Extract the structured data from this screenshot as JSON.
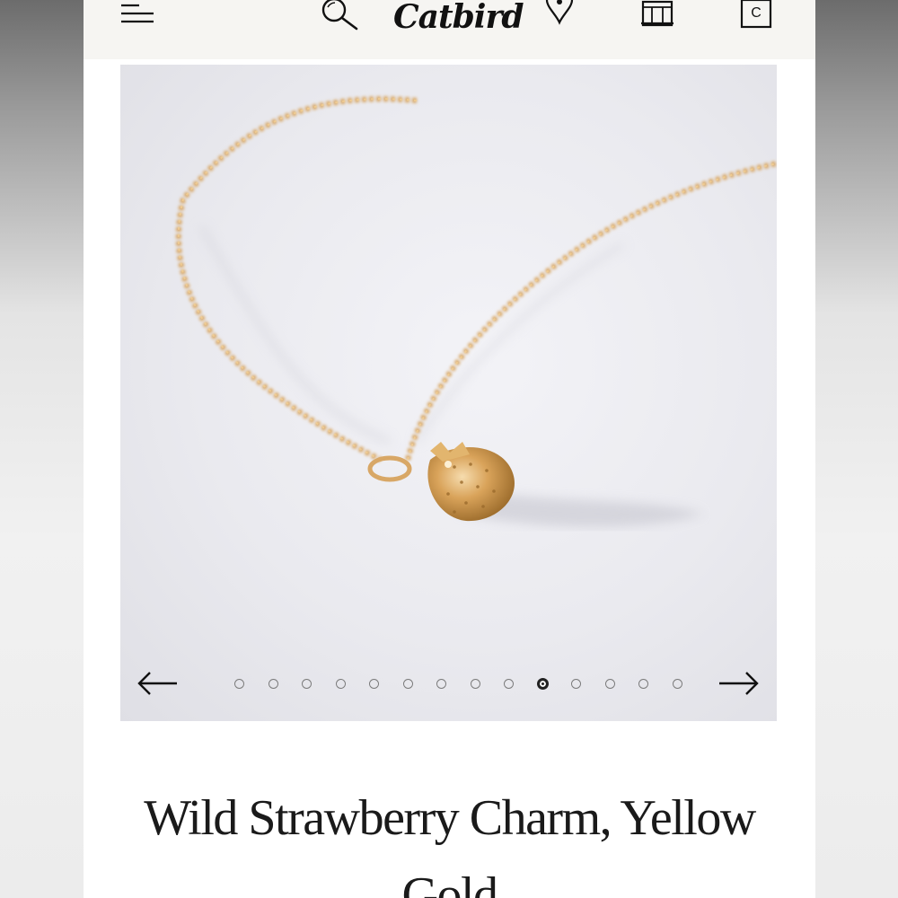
{
  "header": {
    "logo_text": "Catbird",
    "bag_label": "C",
    "icons": [
      "menu-icon",
      "search-icon",
      "location-pin-icon",
      "storefront-icon",
      "shopping-bag-icon"
    ]
  },
  "gallery": {
    "image_alt": "Gold chain necklace with a small strawberry charm",
    "total_images": 14,
    "current_index": 10,
    "prev_icon": "arrow-left-icon",
    "next_icon": "arrow-right-icon"
  },
  "product": {
    "title": "Wild Strawberry Charm, Yellow Gold"
  },
  "colors": {
    "header_bg": "#f6f5f2",
    "gold": "#d9a35a",
    "text": "#1a1a1a"
  }
}
